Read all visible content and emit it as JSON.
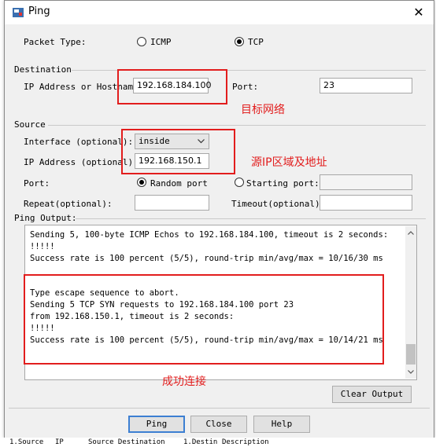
{
  "window": {
    "title": "Ping",
    "close_glyph": "✕",
    "icon": "ping-app-icon"
  },
  "packet_type": {
    "label": "Packet Type:",
    "options": [
      "ICMP",
      "TCP"
    ],
    "selected": "TCP"
  },
  "destination": {
    "section": "Destination",
    "ip_label": "IP Address or Hostname:",
    "ip_value": "192.168.184.100",
    "port_label": "Port:",
    "port_value": "23"
  },
  "source": {
    "section": "Source",
    "interface_label": "Interface (optional):",
    "interface_value": "inside",
    "ip_label": "IP Address (optional):",
    "ip_value": "192.168.150.1",
    "port_label": "Port:",
    "random_port": "Random port",
    "starting_port": "Starting port:",
    "port_mode": "random",
    "repeat_label": "Repeat(optional):",
    "timeout_label": "Timeout(optional):"
  },
  "ping_output": {
    "label": "Ping Output:",
    "lines": [
      "Sending 5, 100-byte ICMP Echos to 192.168.184.100, timeout is 2 seconds:",
      "!!!!!",
      "Success rate is 100 percent (5/5), round-trip min/avg/max = 10/16/30 ms",
      "",
      "Type escape sequence to abort.",
      "Sending 5 TCP SYN requests to 192.168.184.100 port 23",
      "from 192.168.150.1, timeout is 2 seconds:",
      "!!!!!",
      "Success rate is 100 percent (5/5), round-trip min/avg/max = 10/14/21 ms"
    ]
  },
  "buttons": {
    "clear_output": "Clear Output",
    "ping": "Ping",
    "close": "Close",
    "help": "Help"
  },
  "annotations": {
    "target_network": "目标网络",
    "source_ip": "源IP区域及地址",
    "success": "成功连接"
  },
  "annotation_color": "#e21d1d",
  "background_table": {
    "headers": [
      "1.Source",
      "IP",
      "Source Destination",
      "1.Destin",
      "Description"
    ]
  }
}
